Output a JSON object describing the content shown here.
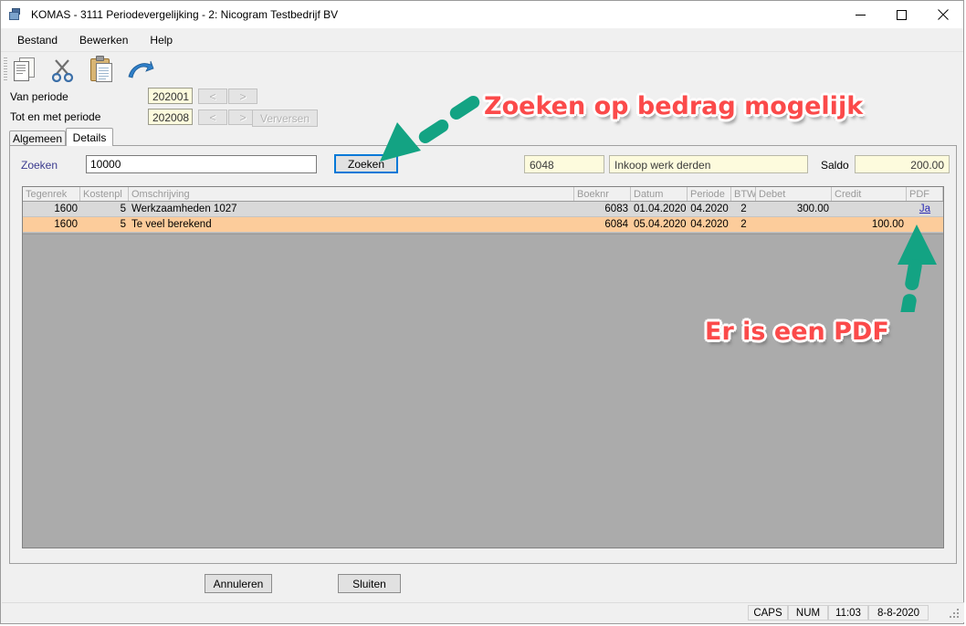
{
  "window": {
    "title": "KOMAS - 3111 Periodevergelijking - 2: Nicogram Testbedrijf BV",
    "minimize_label": "Minimaliseren",
    "maximize_label": "Maximaliseren",
    "close_label": "Sluiten"
  },
  "menu": {
    "items": [
      "Bestand",
      "Bewerken",
      "Help"
    ]
  },
  "toolbar": {
    "icons": [
      "copy-icon",
      "cut-icon",
      "paste-icon",
      "undo-arrow-icon"
    ]
  },
  "periods": {
    "from_label": "Van periode",
    "from_value": "202001",
    "to_label": "Tot en met periode",
    "to_value": "202008",
    "prev_label": "<",
    "next_label": ">",
    "refresh_label": "Verversen"
  },
  "tabs": [
    {
      "label": "Algemeen",
      "active": false
    },
    {
      "label": "Details",
      "active": true
    }
  ],
  "search": {
    "label": "Zoeken",
    "value": "10000",
    "placeholder": "",
    "button_label": "Zoeken"
  },
  "account": {
    "number": "6048",
    "description": "Inkoop werk derden",
    "saldo_label": "Saldo",
    "saldo_value": "200.00"
  },
  "grid": {
    "columns": [
      "Tegenrek",
      "Kostenpl",
      "Omschrijving",
      "Boeknr",
      "Datum",
      "Periode",
      "BTW",
      "Debet",
      "Credit",
      "PDF"
    ],
    "rows": [
      {
        "tegenrek": "1600",
        "kostenpl": "5",
        "omschrijving": "Werkzaamheden 1027",
        "boeknr": "6083",
        "datum": "01.04.2020",
        "periode": "04.2020",
        "btw": "2",
        "debet": "300.00",
        "credit": "",
        "pdf": "Ja",
        "selected": false
      },
      {
        "tegenrek": "1600",
        "kostenpl": "5",
        "omschrijving": "Te veel berekend",
        "boeknr": "6084",
        "datum": "05.04.2020",
        "periode": "04.2020",
        "btw": "2",
        "debet": "",
        "credit": "100.00",
        "pdf": "",
        "selected": true
      }
    ]
  },
  "footer": {
    "cancel_label": "Annuleren",
    "close_label": "Sluiten"
  },
  "statusbar": {
    "caps": "CAPS",
    "num": "NUM",
    "time": "11:03",
    "date": "8-8-2020"
  },
  "annotations": [
    {
      "text": "Zoeken op bedrag mogelijk",
      "color": "#FB4A4A"
    },
    {
      "text": "Er is een PDF",
      "color": "#FB4A4A"
    }
  ],
  "colors": {
    "annotation_red": "#FB4A4A",
    "arrow_green": "#13A383",
    "selected_row": "#FCCC9B",
    "focus_blue": "#0078D7",
    "link_blue": "#2B2BB5"
  }
}
